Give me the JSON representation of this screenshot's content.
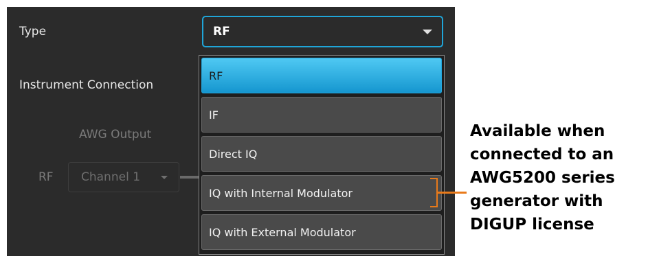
{
  "form": {
    "type_label": "Type",
    "type_value": "RF",
    "instrument_connection_label": "Instrument Connection",
    "awg_output_label": "AWG Output",
    "rf_label": "RF",
    "channel_value": "Channel 1"
  },
  "dropdown": {
    "options": [
      {
        "label": "RF",
        "selected": true
      },
      {
        "label": "IF",
        "selected": false
      },
      {
        "label": "Direct IQ",
        "selected": false
      },
      {
        "label": "IQ with Internal Modulator",
        "selected": false
      },
      {
        "label": "IQ with External Modulator",
        "selected": false
      }
    ]
  },
  "annotation": {
    "lines": [
      "Available when",
      "connected to an",
      "AWG5200 series",
      "generator with",
      "DIGUP license"
    ]
  },
  "colors": {
    "panel_bg": "#2b2b2b",
    "accent_blue": "#1fa5d8",
    "selected_option": "#2cb2e6",
    "option_bg": "#4a4a4a",
    "bracket_orange": "#e97a1a"
  },
  "icons": {
    "type_caret": "chevron-down-icon",
    "channel_caret": "chevron-down-icon"
  }
}
